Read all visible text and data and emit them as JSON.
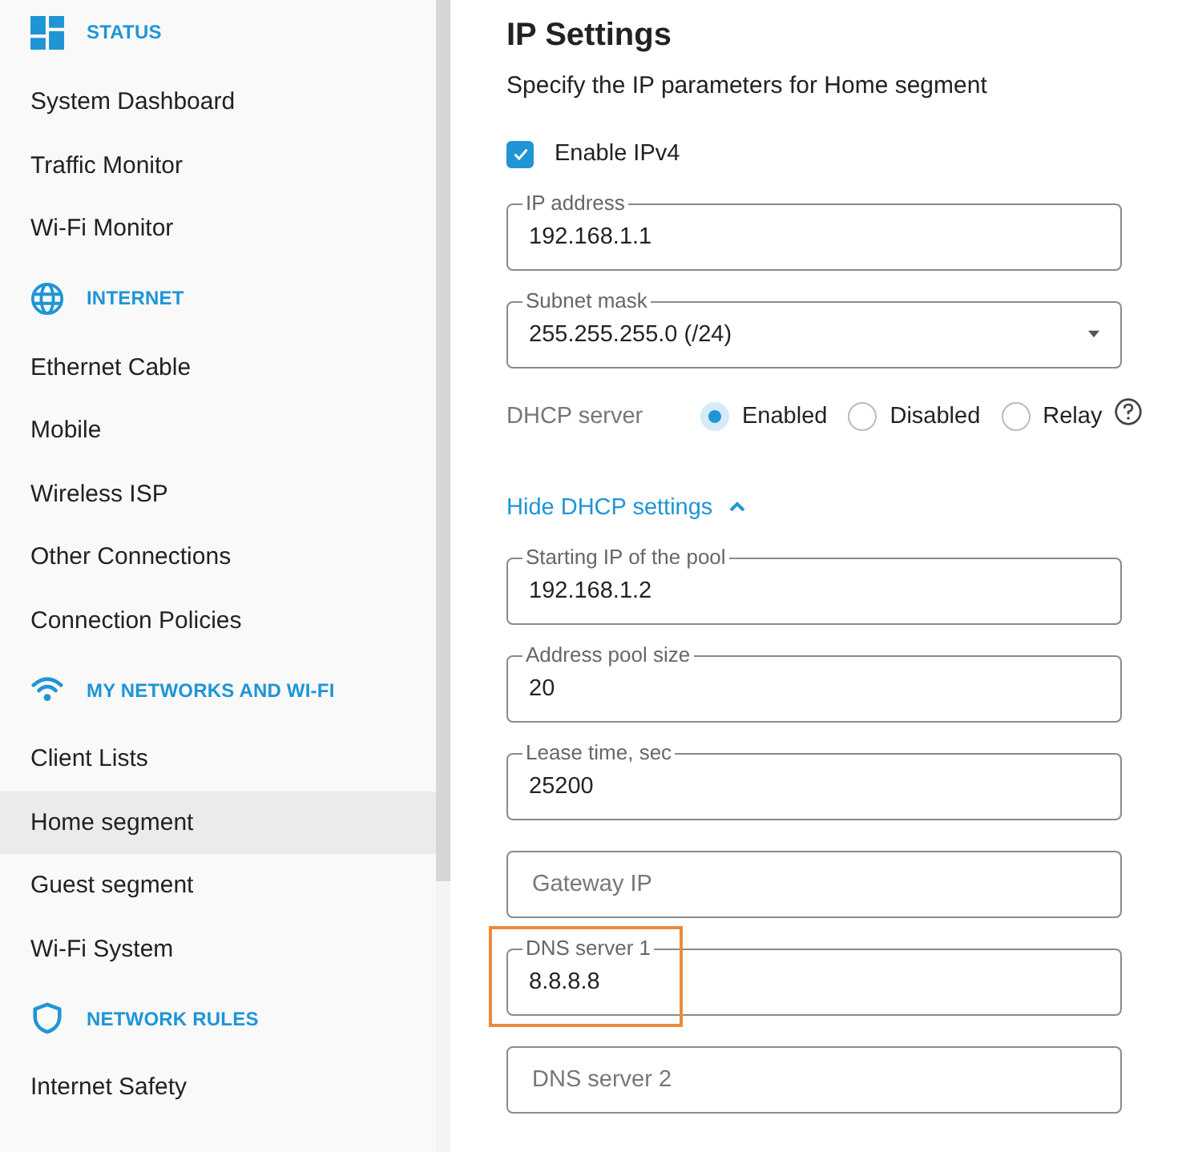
{
  "sidebar": {
    "sections": [
      {
        "title": "STATUS",
        "items": [
          {
            "label": "System Dashboard",
            "selected": false
          },
          {
            "label": "Traffic Monitor",
            "selected": false
          },
          {
            "label": "Wi-Fi Monitor",
            "selected": false
          }
        ]
      },
      {
        "title": "INTERNET",
        "items": [
          {
            "label": "Ethernet Cable",
            "selected": false
          },
          {
            "label": "Mobile",
            "selected": false
          },
          {
            "label": "Wireless ISP",
            "selected": false
          },
          {
            "label": "Other Connections",
            "selected": false
          },
          {
            "label": "Connection Policies",
            "selected": false
          }
        ]
      },
      {
        "title": "MY NETWORKS AND WI-FI",
        "items": [
          {
            "label": "Client Lists",
            "selected": false
          },
          {
            "label": "Home segment",
            "selected": true
          },
          {
            "label": "Guest segment",
            "selected": false
          },
          {
            "label": "Wi-Fi System",
            "selected": false
          }
        ]
      },
      {
        "title": "NETWORK RULES",
        "items": [
          {
            "label": "Internet Safety",
            "selected": false
          }
        ]
      }
    ]
  },
  "page": {
    "title": "IP Settings",
    "subtitle": "Specify the IP parameters for Home segment",
    "enable_ipv4": {
      "label": "Enable IPv4",
      "checked": true
    },
    "fields_top": [
      {
        "kind": "text",
        "label": "IP address",
        "value": "192.168.1.1"
      },
      {
        "kind": "select",
        "label": "Subnet mask",
        "value": "255.255.255.0 (/24)"
      }
    ],
    "dhcp": {
      "label": "DHCP server",
      "options": [
        {
          "label": "Enabled",
          "selected": true
        },
        {
          "label": "Disabled",
          "selected": false
        },
        {
          "label": "Relay",
          "selected": false
        }
      ]
    },
    "dhcp_toggle": {
      "label": "Hide DHCP settings",
      "expanded": true
    },
    "fields_dhcp": [
      {
        "kind": "text",
        "label": "Starting IP of the pool",
        "value": "192.168.1.2",
        "highlighted": false
      },
      {
        "kind": "text",
        "label": "Address pool size",
        "value": "20",
        "highlighted": false
      },
      {
        "kind": "text",
        "label": "Lease time, sec",
        "value": "25200",
        "highlighted": false
      },
      {
        "kind": "text",
        "placeholder": "Gateway IP",
        "highlighted": false
      },
      {
        "kind": "text",
        "label": "DNS server 1",
        "value": "8.8.8.8",
        "highlighted": true
      },
      {
        "kind": "text",
        "placeholder": "DNS server 2",
        "highlighted": false
      }
    ]
  }
}
